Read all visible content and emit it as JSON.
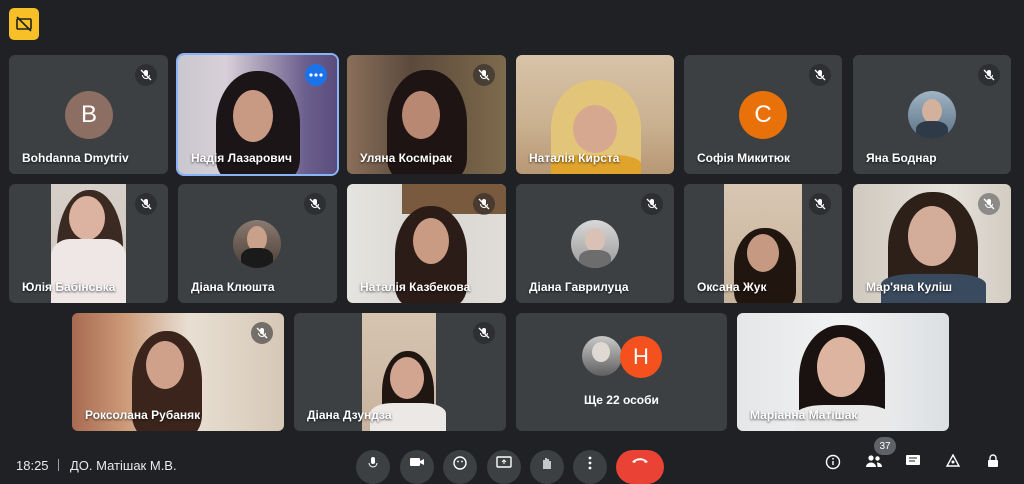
{
  "meeting": {
    "time": "18:25",
    "title": "ДО. Матішак М.В.",
    "participant_count": "37"
  },
  "tiles": [
    {
      "name": "Bohdanna Dmytriv",
      "letter": "B"
    },
    {
      "name": "Надія Лазарович"
    },
    {
      "name": "Уляна Космірак"
    },
    {
      "name": "Наталія Кирста"
    },
    {
      "name": "Софія Микитюк",
      "letter": "C"
    },
    {
      "name": "Яна Боднар"
    },
    {
      "name": "Юлія Бабінська"
    },
    {
      "name": "Діана Клюшта"
    },
    {
      "name": "Наталія Казбекова"
    },
    {
      "name": "Діана Гаврилуца"
    },
    {
      "name": "Оксана Жук"
    },
    {
      "name": "Мар'яна Куліш"
    },
    {
      "name": "Роксолана Рубаняк"
    },
    {
      "name": "Діана Дзундза"
    },
    {
      "name": "Ще 22 особи",
      "letter": "H"
    },
    {
      "name": "Маріанна Матішак"
    }
  ],
  "colors": {
    "background": "#202124",
    "tile": "#3c4043",
    "active_border": "#8ab4f8",
    "end_call": "#ea4335",
    "badge": "#f6c026",
    "avatar_b": "#8d6e63",
    "avatar_c": "#e8710a",
    "avatar_h": "#f4511e"
  },
  "icons": {
    "badge": "captions-off-icon",
    "tile_status": "mic-off-icon",
    "controls": [
      "mic-icon",
      "camera-icon",
      "emoji-icon",
      "present-icon",
      "raise-hand-icon",
      "more-options-icon",
      "end-call-icon"
    ],
    "right": [
      "info-icon",
      "people-icon",
      "chat-icon",
      "activities-icon",
      "lock-icon"
    ]
  }
}
